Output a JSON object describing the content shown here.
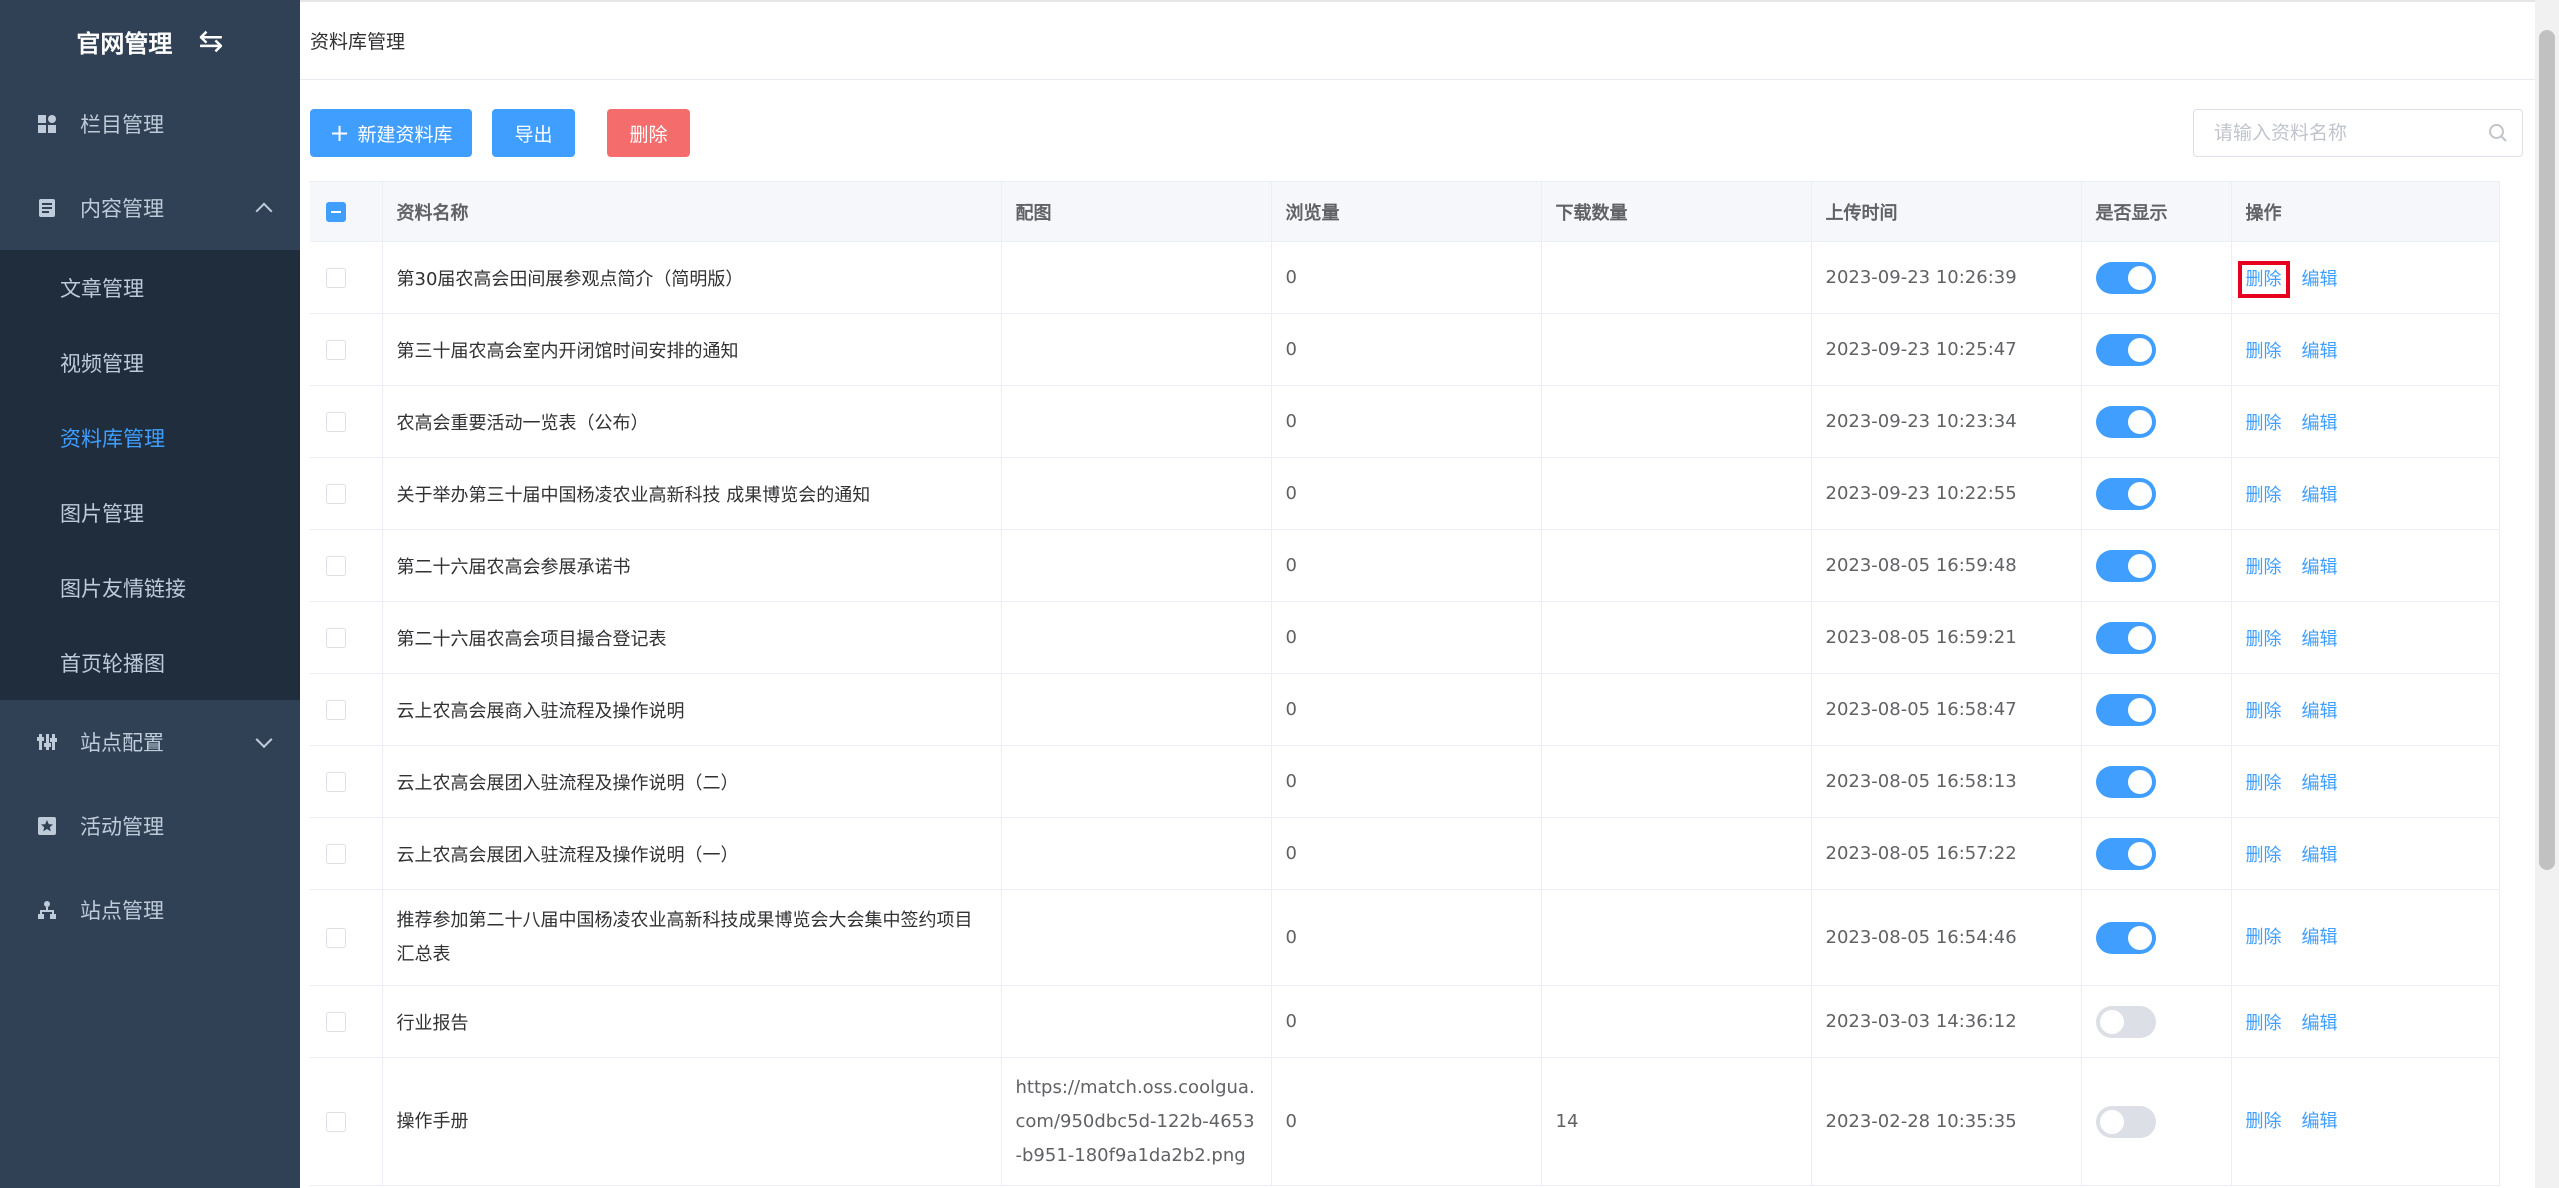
{
  "sidebar": {
    "brand": "官网管理",
    "brand_icon": "swap-icon",
    "items": [
      {
        "label": "栏目管理",
        "icon": "grid-icon"
      },
      {
        "label": "内容管理",
        "icon": "document-icon"
      },
      {
        "label": "站点配置",
        "icon": "sliders-icon"
      },
      {
        "label": "活动管理",
        "icon": "star-box-icon"
      },
      {
        "label": "站点管理",
        "icon": "sitemap-icon"
      }
    ],
    "submenu": [
      "文章管理",
      "视频管理",
      "资料库管理",
      "图片管理",
      "图片友情链接",
      "首页轮播图"
    ],
    "active_sub": "资料库管理"
  },
  "breadcrumb": "资料库管理",
  "toolbar": {
    "new_label": "新建资料库",
    "export_label": "导出",
    "delete_label": "删除",
    "search_placeholder": "请输入资料名称"
  },
  "table": {
    "headers": [
      "资料名称",
      "配图",
      "浏览量",
      "下载数量",
      "上传时间",
      "是否显示",
      "操作"
    ],
    "rows": [
      {
        "name": "第30届农高会田间展参观点简介（简明版）",
        "image": "",
        "views": "0",
        "downloads": "",
        "time": "2023-09-23 10:26:39",
        "show": true
      },
      {
        "name": "第三十届农高会室内开闭馆时间安排的通知",
        "image": "",
        "views": "0",
        "downloads": "",
        "time": "2023-09-23 10:25:47",
        "show": true
      },
      {
        "name": "农高会重要活动一览表（公布）",
        "image": "",
        "views": "0",
        "downloads": "",
        "time": "2023-09-23 10:23:34",
        "show": true
      },
      {
        "name": "关于举办第三十届中国杨凌农业高新科技 成果博览会的通知",
        "image": "",
        "views": "0",
        "downloads": "",
        "time": "2023-09-23 10:22:55",
        "show": true
      },
      {
        "name": "第二十六届农高会参展承诺书",
        "image": "",
        "views": "0",
        "downloads": "",
        "time": "2023-08-05 16:59:48",
        "show": true
      },
      {
        "name": "第二十六届农高会项目撮合登记表",
        "image": "",
        "views": "0",
        "downloads": "",
        "time": "2023-08-05 16:59:21",
        "show": true
      },
      {
        "name": "云上农高会展商入驻流程及操作说明",
        "image": "",
        "views": "0",
        "downloads": "",
        "time": "2023-08-05 16:58:47",
        "show": true
      },
      {
        "name": "云上农高会展团入驻流程及操作说明（二）",
        "image": "",
        "views": "0",
        "downloads": "",
        "time": "2023-08-05 16:58:13",
        "show": true
      },
      {
        "name": "云上农高会展团入驻流程及操作说明（一）",
        "image": "",
        "views": "0",
        "downloads": "",
        "time": "2023-08-05 16:57:22",
        "show": true
      },
      {
        "name": "推荐参加第二十八届中国杨凌农业高新科技成果博览会大会集中签约项目汇总表",
        "image": "",
        "views": "0",
        "downloads": "",
        "time": "2023-08-05 16:54:46",
        "show": true
      },
      {
        "name": "行业报告",
        "image": "",
        "views": "0",
        "downloads": "",
        "time": "2023-03-03 14:36:12",
        "show": false
      },
      {
        "name": "操作手册",
        "image": "https://match.oss.coolgua.com/950dbc5d-122b-4653-b951-180f9a1da2b2.png",
        "views": "0",
        "downloads": "14",
        "time": "2023-02-28 10:35:35",
        "show": false
      }
    ],
    "actions": {
      "delete": "删除",
      "edit": "编辑"
    }
  },
  "colors": {
    "sidebar_bg": "#304156",
    "submenu_bg": "#1f2d3d",
    "primary": "#409eff",
    "danger": "#f56c6c",
    "highlight": "#e8001f"
  }
}
